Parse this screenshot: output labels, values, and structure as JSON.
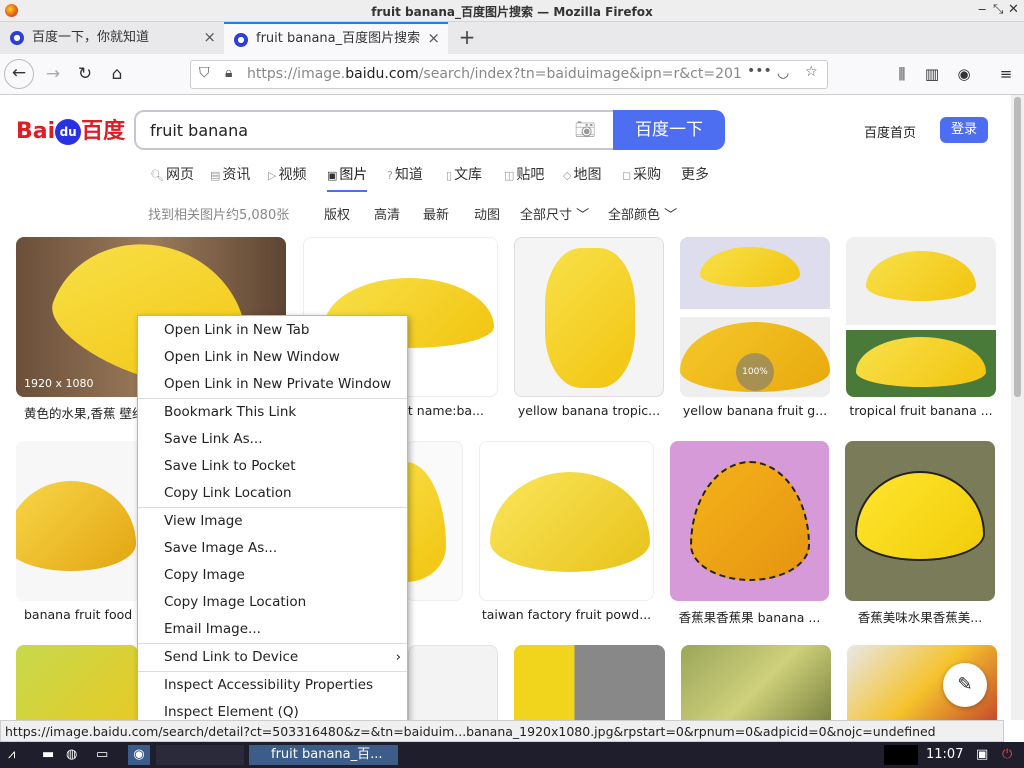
{
  "window": {
    "title": "fruit banana_百度图片搜索 — Mozilla Firefox"
  },
  "tabs": [
    {
      "label": "百度一下，你就知道"
    },
    {
      "label": "fruit banana_百度图片搜索"
    }
  ],
  "nav": {
    "url_prefix": "https://image.",
    "url_domain": "baidu.com",
    "url_rest": "/search/index?tn=baiduimage&ipn=r&ct=201"
  },
  "baidu": {
    "logo_left": "Bai",
    "logo_du": "du",
    "logo_right": "百度",
    "query": "fruit banana",
    "search_button": "百度一下",
    "home_link": "百度首页",
    "login_button": "登录",
    "tabs": [
      "网页",
      "资讯",
      "视频",
      "图片",
      "知道",
      "文库",
      "贴吧",
      "地图",
      "采购",
      "更多"
    ],
    "result_count": "找到相关图片约5,080张",
    "filters": [
      "版权",
      "高清",
      "最新",
      "动图",
      "全部尺寸",
      "全部颜色"
    ]
  },
  "results": {
    "r1": {
      "caption": "黄色的水果,香蕉 壁纸",
      "dims": "1920 x 1080"
    },
    "r2": {
      "caption": "ct name:ba..."
    },
    "r3": {
      "caption": "yellow banana tropic..."
    },
    "r4": {
      "caption": "yellow banana fruit g...",
      "badge": "100%"
    },
    "r5": {
      "caption": "tropical fruit banana ..."
    },
    "r6": {
      "caption": "banana fruit food"
    },
    "r8": {
      "caption": "taiwan factory fruit powd..."
    },
    "r9": {
      "caption": "香蕉果香蕉果 banana ..."
    },
    "r10": {
      "caption": "香蕉美味水果香蕉美..."
    }
  },
  "context_menu": [
    "Open Link in New Tab",
    "Open Link in New Window",
    "Open Link in New Private Window",
    "Bookmark This Link",
    "Save Link As...",
    "Save Link to Pocket",
    "Copy Link Location",
    "View Image",
    "Save Image As...",
    "Copy Image",
    "Copy Image Location",
    "Email Image...",
    "Send Link to Device",
    "Inspect Accessibility Properties",
    "Inspect Element (Q)"
  ],
  "status_url": "https://image.baidu.com/search/detail?ct=503316480&z=&tn=baiduim...banana_1920x1080.jpg&rpstart=0&rpnum=0&adpicid=0&nojc=undefined",
  "taskbar": {
    "window_label": "fruit banana_百...",
    "clock": "11:07"
  }
}
